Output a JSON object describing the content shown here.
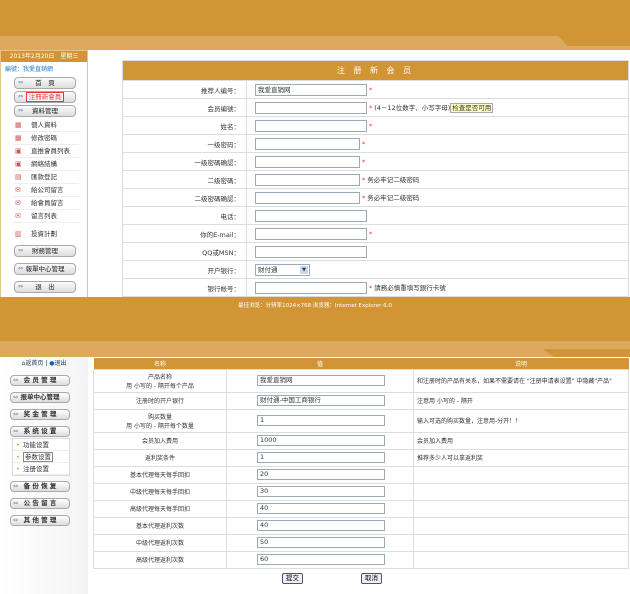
{
  "top": {
    "date": "2013年2月20日　星期三",
    "user": "編號：我愛直銷網"
  },
  "side1": {
    "buttons": [
      {
        "label": "首　頁",
        "active": false
      },
      {
        "label": "注冊新會員",
        "active": true
      },
      {
        "label": "資料管理",
        "active": false
      }
    ],
    "subs": [
      {
        "label": "個人資料",
        "icon": "calendar-icon"
      },
      {
        "label": "修改密碼",
        "icon": "calendar-icon"
      },
      {
        "label": "直推會員列表",
        "icon": "list-icon"
      },
      {
        "label": "網絡結構",
        "icon": "tree-icon"
      },
      {
        "label": "匯款登記",
        "icon": "note-icon"
      },
      {
        "label": "給公司留言",
        "icon": "message-icon"
      },
      {
        "label": "給會員留言",
        "icon": "message-icon"
      },
      {
        "label": "留言列表",
        "icon": "mail-icon"
      },
      {
        "label": "投資計劃",
        "icon": "chart-icon"
      }
    ],
    "bottom": [
      {
        "label": "財務管理"
      },
      {
        "label": "報單中心管理"
      },
      {
        "label": "退　出"
      }
    ]
  },
  "form": {
    "title": "注 册 新 会 员",
    "rows": [
      {
        "label": "推荐人编号：",
        "value": "我爱直销网",
        "w": 112,
        "star": true,
        "note": ""
      },
      {
        "label": "会员编號：",
        "value": "",
        "w": 112,
        "star": true,
        "note": "(4－12位数字、小写字母)",
        "check": "检查是否可用"
      },
      {
        "label": "姓名：",
        "value": "",
        "w": 112,
        "star": true,
        "note": ""
      },
      {
        "label": "一级密码：",
        "value": "",
        "w": 105,
        "star": true,
        "note": ""
      },
      {
        "label": "一级密碼确認：",
        "value": "",
        "w": 105,
        "star": true,
        "note": ""
      },
      {
        "label": "二级密碼：",
        "value": "",
        "w": 105,
        "star": true,
        "note": "务必牢记二级密码"
      },
      {
        "label": "二级密碼确認：",
        "value": "",
        "w": 105,
        "star": true,
        "note": "务必牢记二级密码"
      },
      {
        "label": "电话：",
        "value": "",
        "w": 112,
        "star": false,
        "note": ""
      },
      {
        "label": "你的E-mail：",
        "value": "",
        "w": 112,
        "star": true,
        "note": ""
      },
      {
        "label": "QQ或MSN：",
        "value": "",
        "w": 112,
        "star": false,
        "note": ""
      },
      {
        "label": "开户银行：",
        "select": "财付通",
        "star": false,
        "note": ""
      },
      {
        "label": "银行帐号：",
        "value": "",
        "w": 112,
        "star": true,
        "note": "請務必慎重填写銀行卡號"
      }
    ]
  },
  "footer": "最佳浏览：分辨率1024×768 浏览器：Internet Explorer 6.0",
  "side2": {
    "home": "返首页",
    "logout": "退出",
    "buttons": [
      "会 员 管 理",
      "报单中心管理",
      "奖 金 管 理",
      "系 统 设 置"
    ],
    "subs": [
      {
        "label": "功能设置",
        "current": false
      },
      {
        "label": "参数设置",
        "current": true
      },
      {
        "label": "注册设置",
        "current": false
      }
    ],
    "buttons2": [
      "备 份 恢 复",
      "公 告 留 言",
      "其 他 管 理"
    ]
  },
  "config": {
    "headers": [
      "名称",
      "值",
      "说明"
    ],
    "rows": [
      {
        "name": "产品名称",
        "name2": "用 小写的 - 隔开每个产品",
        "value": "我爱直销网",
        "desc": "和注册时的产品有关系，如果不需要请在 \"注册申请表设置\" 中隐藏\"产品\""
      },
      {
        "name": "注册时的开户银行",
        "value": "财付通-中国工商银行",
        "desc": "注意用 小写的 - 隔开"
      },
      {
        "name": "购买数量",
        "name2": "用 小写的 - 隔开每个数量",
        "value": "1",
        "desc": "输入可选的购买数量，注意用-分开！！"
      },
      {
        "name": "会员加入费用",
        "value": "1000",
        "desc": "会员加入费用"
      },
      {
        "name": "返利奖条件",
        "value": "1",
        "desc": "推荐多少人可以拿返利奖"
      },
      {
        "name": "基本代理每天每手回扣",
        "value": "20",
        "desc": ""
      },
      {
        "name": "中级代理每天每手回扣",
        "value": "30",
        "desc": ""
      },
      {
        "name": "高级代理每天每手回扣",
        "value": "40",
        "desc": ""
      },
      {
        "name": "基本代理返利次数",
        "value": "40",
        "desc": ""
      },
      {
        "name": "中级代理返利次数",
        "value": "50",
        "desc": ""
      },
      {
        "name": "高级代理返利次数",
        "value": "60",
        "desc": ""
      }
    ],
    "submit": "提交",
    "cancel": "取消"
  }
}
